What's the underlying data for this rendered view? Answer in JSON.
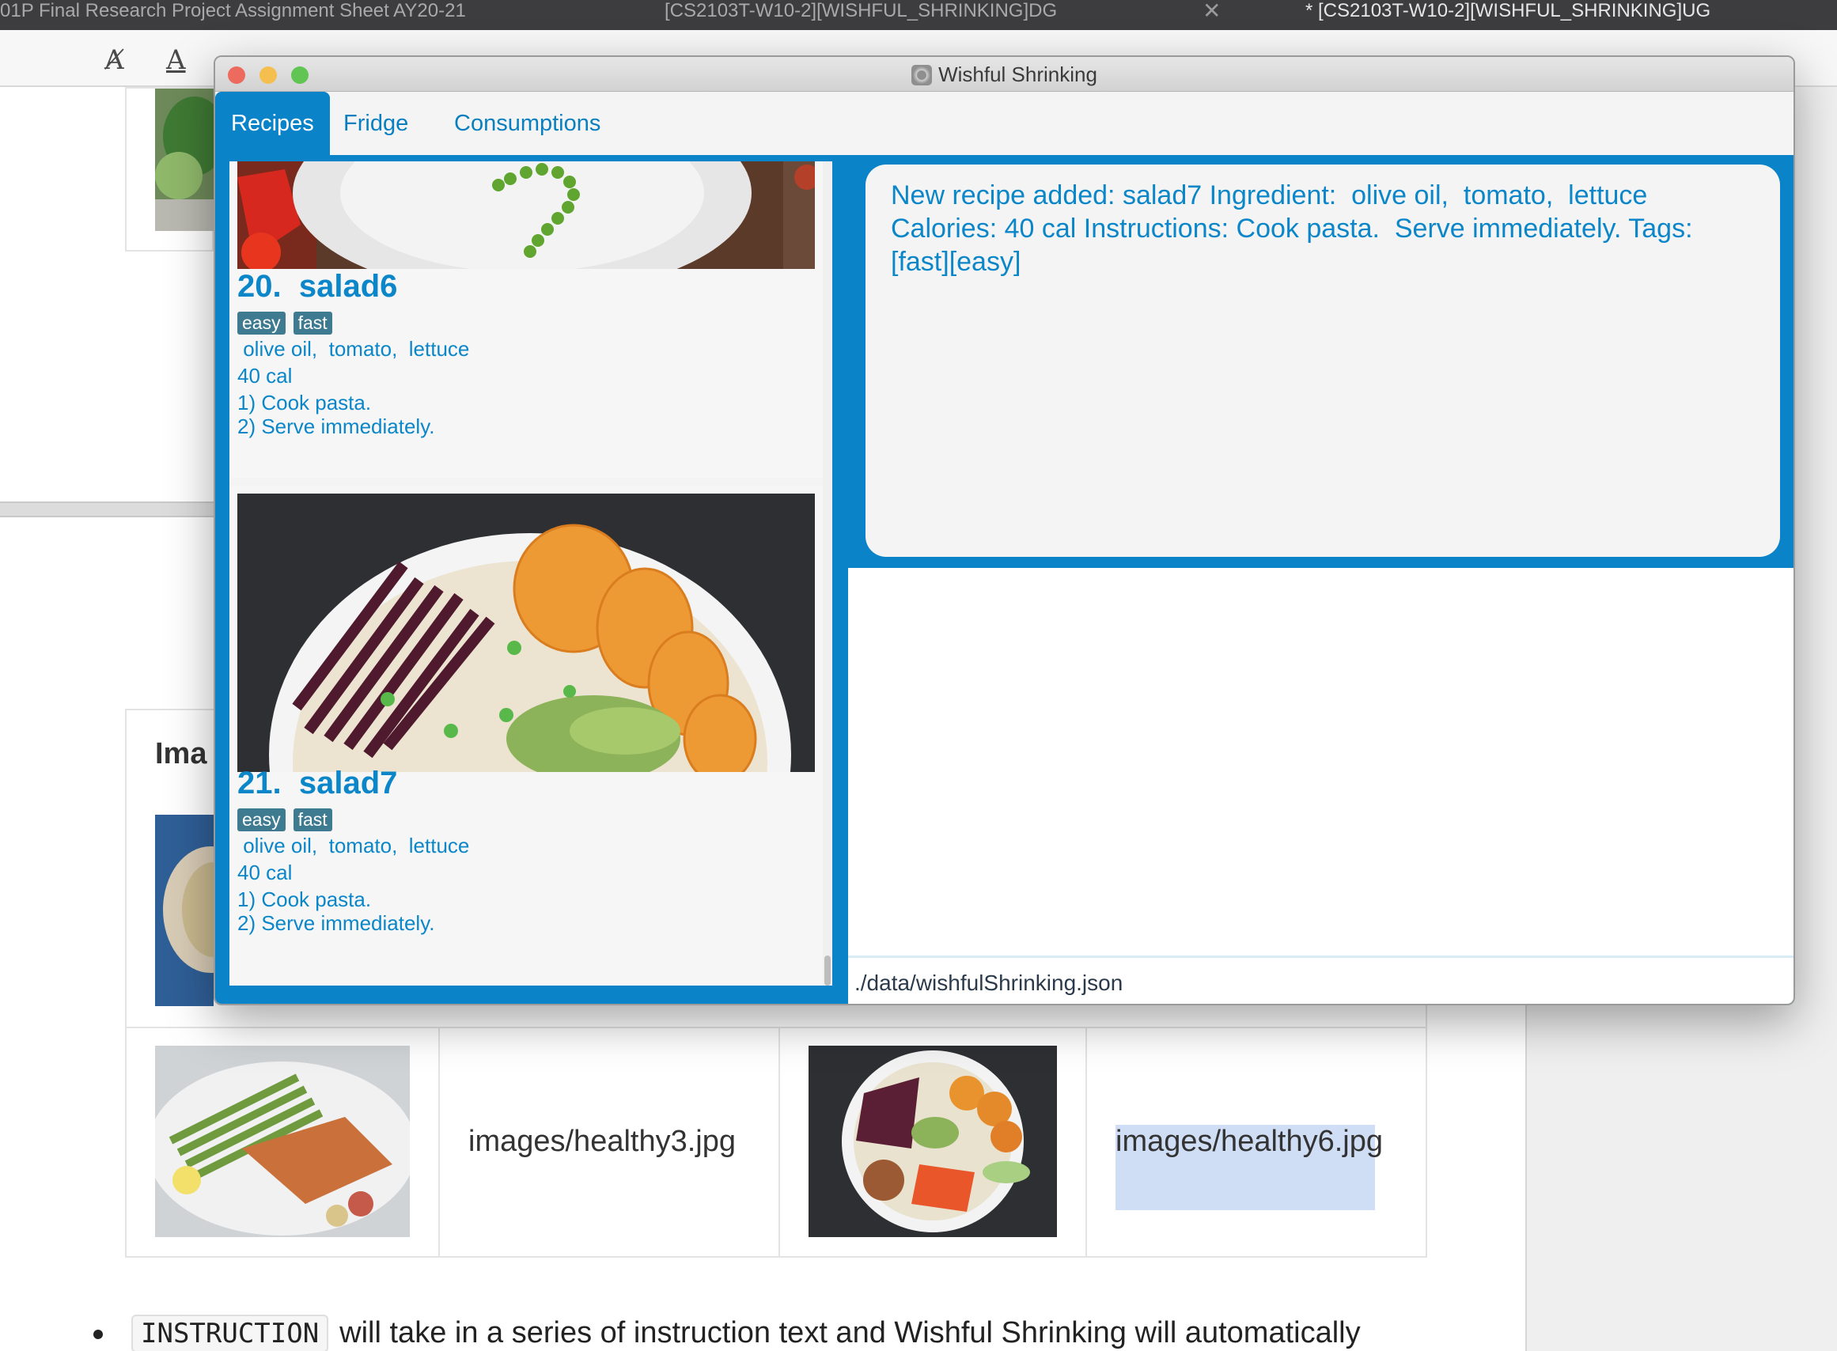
{
  "editor": {
    "tabs": [
      "01P Final Research Project Assignment Sheet AY20-21",
      "[CS2103T-W10-2][WISHFUL_SHRINKING]DG",
      "* [CS2103T-W10-2][WISHFUL_SHRINKING]UG"
    ],
    "table_heading": "Ima",
    "image_paths": [
      "images/healthy3.jpg",
      "images/healthy6.jpg"
    ],
    "bullet_code": "INSTRUCTION",
    "bullet_text": "will take in a series of instruction text and Wishful Shrinking will automatically"
  },
  "app": {
    "title": "Wishful Shrinking",
    "tabs": [
      "Recipes",
      "Fridge",
      "Consumptions"
    ],
    "active_tab": "Recipes",
    "recipes": [
      {
        "index": "20.",
        "name": "salad6",
        "tags": [
          "easy",
          "fast"
        ],
        "ingredients": " olive oil,  tomato,  lettuce",
        "calories": "40 cal",
        "instructions": [
          "1) Cook pasta.",
          "2) Serve immediately."
        ]
      },
      {
        "index": "21.",
        "name": "salad7",
        "tags": [
          "easy",
          "fast"
        ],
        "ingredients": " olive oil,  tomato,  lettuce",
        "calories": "40 cal",
        "instructions": [
          "1) Cook pasta.",
          "2) Serve immediately."
        ]
      }
    ],
    "result_message": "New recipe added: salad7 Ingredient:  olive oil,  tomato,  lettuce\nCalories: 40 cal Instructions: Cook pasta.  Serve immediately. Tags:\n[fast][easy]",
    "status_path": "./data/wishfulShrinking.json"
  },
  "colors": {
    "accent": "#0b83c9",
    "accent_text": "#0a86c9",
    "tag_bg": "#3e7b91",
    "close": "#ed6a5e",
    "minimize": "#f5bf4f",
    "maximize": "#61c554"
  }
}
